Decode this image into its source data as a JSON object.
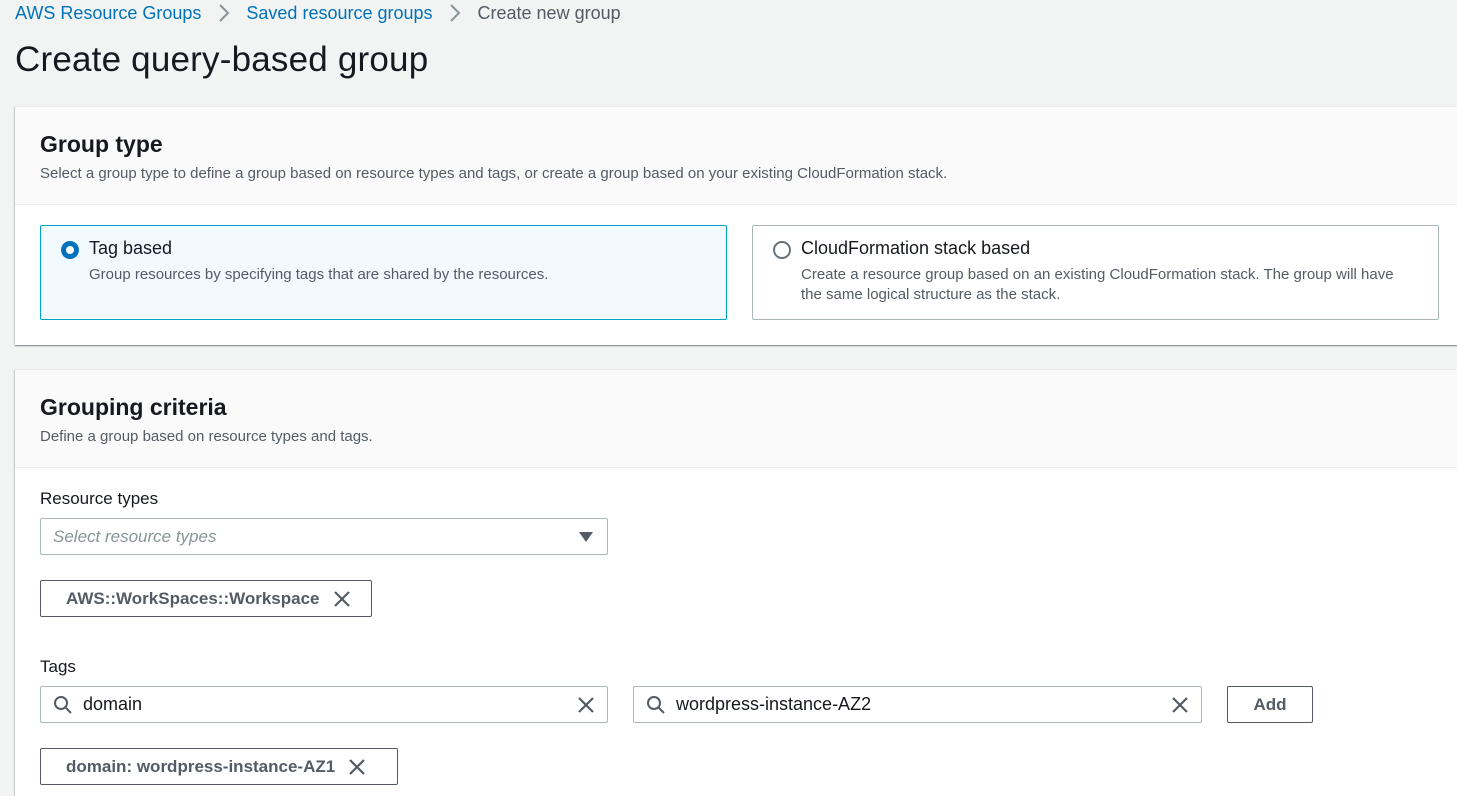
{
  "breadcrumb": {
    "items": [
      {
        "label": "AWS Resource Groups"
      },
      {
        "label": "Saved resource groups"
      },
      {
        "label": "Create new group"
      }
    ]
  },
  "page_title": "Create query-based group",
  "group_type": {
    "title": "Group type",
    "description": "Select a group type to define a group based on resource types and tags, or create a group based on your existing CloudFormation stack.",
    "options": [
      {
        "title": "Tag based",
        "description": "Group resources by specifying tags that are shared by the resources.",
        "selected": true
      },
      {
        "title": "CloudFormation stack based",
        "description": "Create a resource group based on an existing CloudFormation stack. The group will have the same logical structure as the stack.",
        "selected": false
      }
    ]
  },
  "grouping_criteria": {
    "title": "Grouping criteria",
    "description": "Define a group based on resource types and tags.",
    "resource_types": {
      "label": "Resource types",
      "placeholder": "Select resource types",
      "tokens": [
        "AWS::WorkSpaces::Workspace"
      ]
    },
    "tags": {
      "label": "Tags",
      "key_value": "domain",
      "value_value": "wordpress-instance-AZ2",
      "add_label": "Add",
      "tokens": [
        "domain: wordpress-instance-AZ1"
      ]
    }
  },
  "colors": {
    "link": "#0073bb",
    "selected_border": "#00a1c9",
    "selected_bg": "#f1faff",
    "background": "#f2f3f3"
  }
}
